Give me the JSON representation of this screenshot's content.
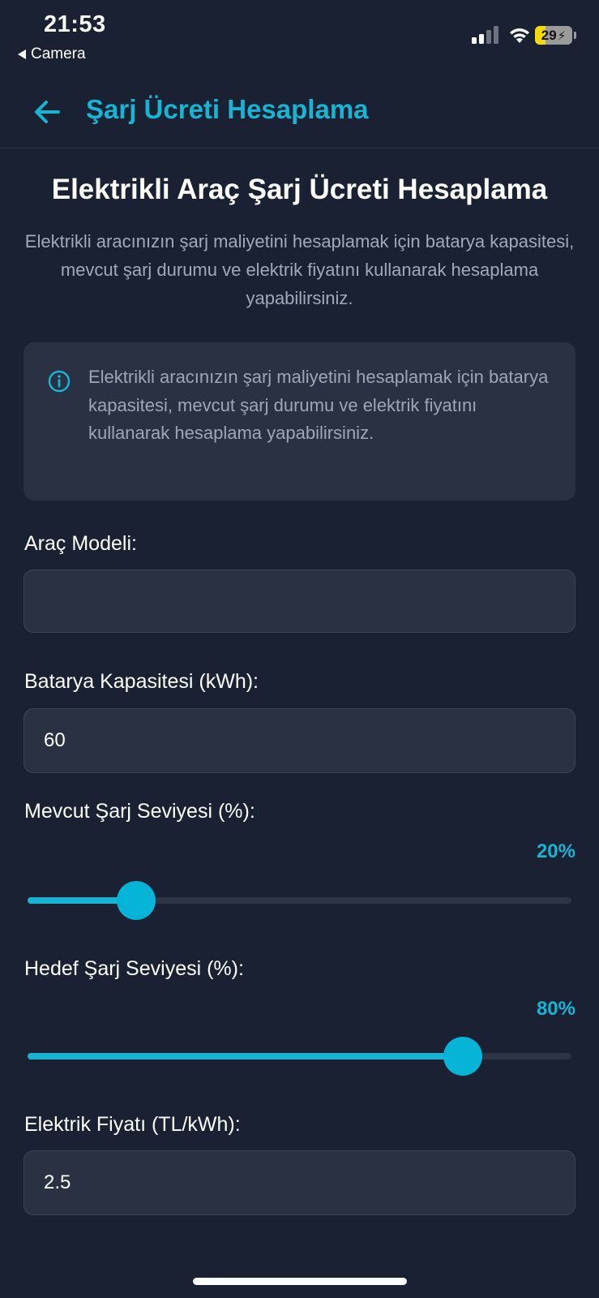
{
  "status_bar": {
    "time": "21:53",
    "back_app": "Camera",
    "battery_level": "29",
    "battery_percent": 29,
    "signal_bars_active": 2,
    "signal_bars_total": 4,
    "icons": [
      "signal-icon",
      "wifi-icon",
      "battery-charging-icon"
    ]
  },
  "header": {
    "title": "Şarj Ücreti Hesaplama",
    "back_icon": "arrow-left-icon"
  },
  "intro": {
    "title": "Elektrikli Araç Şarj Ücreti Hesaplama",
    "description": "Elektrikli aracınızın şarj maliyetini hesaplamak için batarya kapasitesi, mevcut şarj durumu ve elektrik fiyatını kullanarak hesaplama yapabilirsiniz."
  },
  "info_box": {
    "icon": "info-icon",
    "text": "Elektrikli aracınızın şarj maliyetini hesaplamak için batarya kapasitesi, mevcut şarj durumu ve elektrik fiyatını kullanarak hesaplama yapabilirsiniz."
  },
  "form": {
    "vehicle_model": {
      "label": "Araç Modeli:",
      "value": ""
    },
    "battery_capacity": {
      "label": "Batarya Kapasitesi (kWh):",
      "value": "60"
    },
    "current_charge": {
      "label": "Mevcut Şarj Seviyesi (%):",
      "value_text": "20%",
      "value": 20,
      "min": 0,
      "max": 100
    },
    "target_charge": {
      "label": "Hedef Şarj Seviyesi (%):",
      "value_text": "80%",
      "value": 80,
      "min": 0,
      "max": 100
    },
    "electricity_price": {
      "label": "Elektrik Fiyatı (TL/kWh):",
      "value": "2.5"
    }
  },
  "colors": {
    "background": "#1a2132",
    "accent": "#18b4d4",
    "card": "#2a3142",
    "muted_text": "#a2a9b6",
    "battery_fill": "#f5d90a"
  }
}
